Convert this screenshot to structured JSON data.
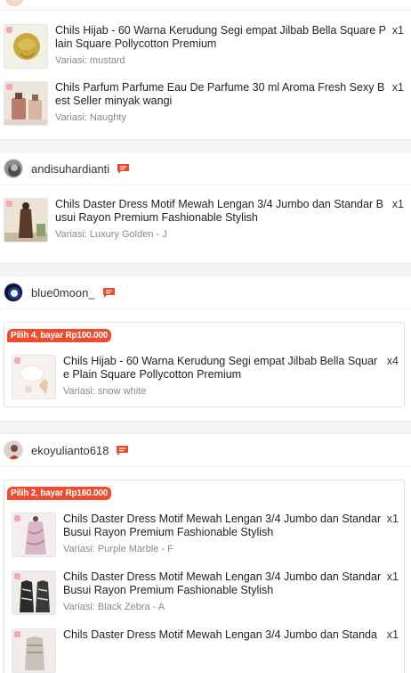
{
  "groups": [
    {
      "id": "top",
      "items": [
        {
          "name": "Chils Hijab - 60 Warna Kerudung Segi empat Jilbab Bella Square Plain Square Pollycotton Premium",
          "variant": "Variasi: mustard",
          "qty": "x1"
        },
        {
          "name": "Chils Parfum Parfume Eau De Parfume 30 ml Aroma Fresh Sexy Best Seller minyak wangi",
          "variant": "Variasi: Naughty",
          "qty": "x1"
        }
      ]
    },
    {
      "shop": "andisuhardianti",
      "items": [
        {
          "name": "Chils Daster Dress Motif Mewah Lengan 3/4 Jumbo dan Standar Busui Rayon Premium Fashionable Stylish",
          "variant": "Variasi: Luxury Golden - J",
          "qty": "x1"
        }
      ]
    },
    {
      "shop": "blue0moon_",
      "promo": "Pilih 4, bayar Rp100.000",
      "items": [
        {
          "name": "Chils Hijab - 60 Warna Kerudung Segi empat Jilbab Bella Square Plain Square Pollycotton Premium",
          "variant": "Variasi: snow white",
          "qty": "x4"
        }
      ]
    },
    {
      "shop": "ekoyulianto618",
      "promo": "Pilih 2, bayar Rp160.000",
      "items": [
        {
          "name": "Chils Daster Dress Motif Mewah Lengan 3/4 Jumbo dan Standar Busui Rayon Premium Fashionable Stylish",
          "variant": "Variasi: Purple Marble - F",
          "qty": "x1"
        },
        {
          "name": "Chils Daster Dress Motif Mewah Lengan 3/4 Jumbo dan Standar Busui Rayon Premium Fashionable Stylish",
          "variant": "Variasi: Black Zebra - A",
          "qty": "x1"
        },
        {
          "name": "Chils Daster Dress Motif Mewah Lengan 3/4 Jumbo dan Standa",
          "variant": "",
          "qty": "x1"
        }
      ]
    }
  ],
  "colors": {
    "accent": "#ee4d2d",
    "divider": "#f5f5f5"
  },
  "icons": {
    "chat": "chat-bubble-icon"
  }
}
